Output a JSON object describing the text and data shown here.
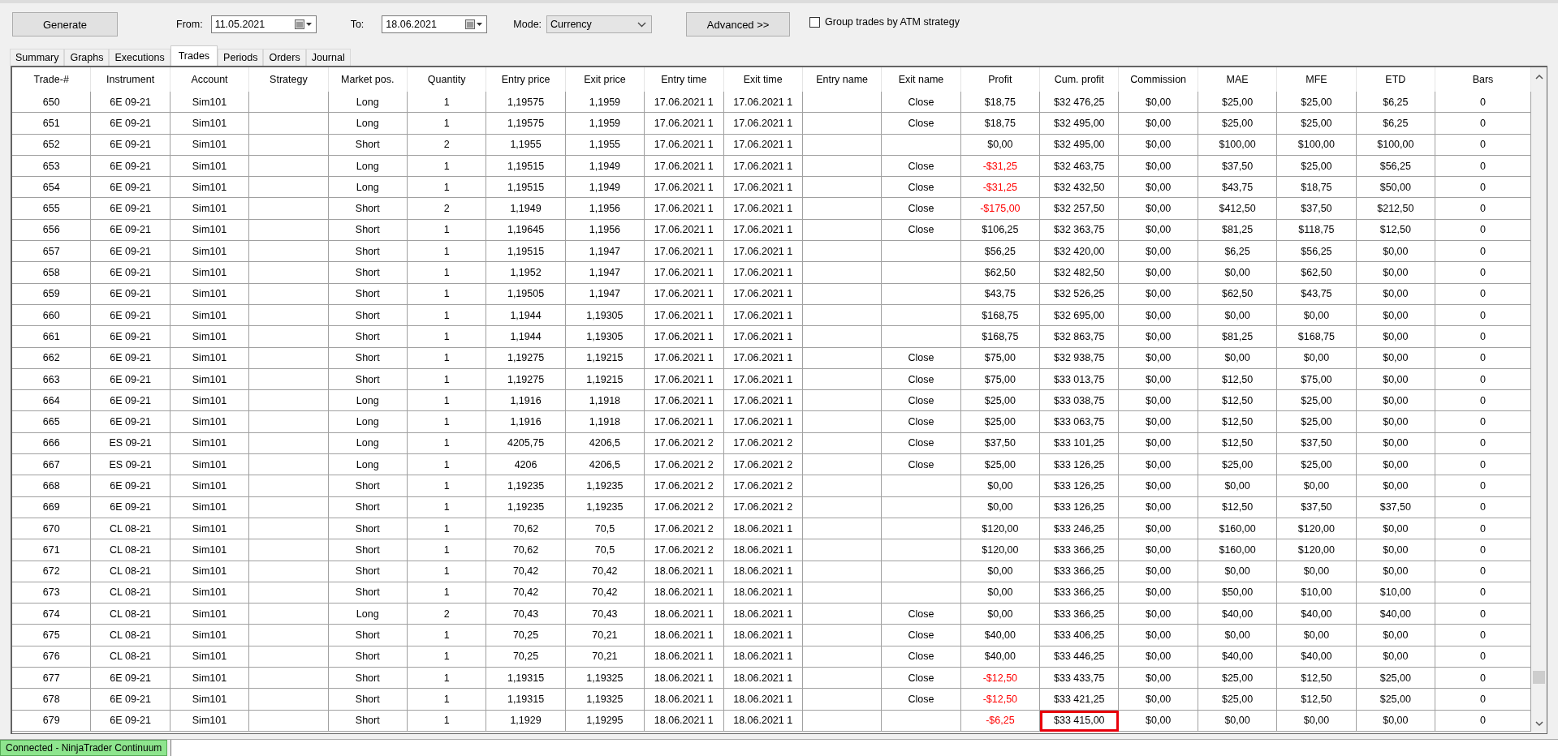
{
  "toolbar": {
    "generate_button": "Generate",
    "from_label": "From:",
    "from_date": "11.05.2021",
    "to_label": "To:",
    "to_date": "18.06.2021",
    "mode_label": "Mode:",
    "mode_value": "Currency",
    "advanced_button": "Advanced >>",
    "group_checkbox": {
      "label": "Group trades by ATM strategy",
      "checked": false
    }
  },
  "tabs": [
    {
      "label": "Summary",
      "selected": false
    },
    {
      "label": "Graphs",
      "selected": false
    },
    {
      "label": "Executions",
      "selected": false
    },
    {
      "label": "Trades",
      "selected": true
    },
    {
      "label": "Periods",
      "selected": false
    },
    {
      "label": "Orders",
      "selected": false
    },
    {
      "label": "Journal",
      "selected": false
    }
  ],
  "table": {
    "columns": [
      "Trade-#",
      "Instrument",
      "Account",
      "Strategy",
      "Market pos.",
      "Quantity",
      "Entry price",
      "Exit price",
      "Entry time",
      "Exit time",
      "Entry name",
      "Exit name",
      "Profit",
      "Cum. profit",
      "Commission",
      "MAE",
      "MFE",
      "ETD",
      "Bars"
    ],
    "rows": [
      {
        "cells": [
          "650",
          "6E 09-21",
          "Sim101",
          null,
          "Long",
          "1",
          "1,19575",
          "1,1959",
          "17.06.2021 1",
          "17.06.2021 1",
          null,
          "Close",
          "$18,75",
          "$32 476,25",
          "$0,00",
          "$25,00",
          "$25,00",
          "$6,25",
          "0"
        ],
        "loss": false,
        "highlighted": false
      },
      {
        "cells": [
          "651",
          "6E 09-21",
          "Sim101",
          null,
          "Long",
          "1",
          "1,19575",
          "1,1959",
          "17.06.2021 1",
          "17.06.2021 1",
          null,
          "Close",
          "$18,75",
          "$32 495,00",
          "$0,00",
          "$25,00",
          "$25,00",
          "$6,25",
          "0"
        ],
        "loss": false,
        "highlighted": false
      },
      {
        "cells": [
          "652",
          "6E 09-21",
          "Sim101",
          null,
          "Short",
          "2",
          "1,1955",
          "1,1955",
          "17.06.2021 1",
          "17.06.2021 1",
          null,
          null,
          "$0,00",
          "$32 495,00",
          "$0,00",
          "$100,00",
          "$100,00",
          "$100,00",
          "0"
        ],
        "loss": false,
        "highlighted": false
      },
      {
        "cells": [
          "653",
          "6E 09-21",
          "Sim101",
          null,
          "Long",
          "1",
          "1,19515",
          "1,1949",
          "17.06.2021 1",
          "17.06.2021 1",
          null,
          "Close",
          "-$31,25",
          "$32 463,75",
          "$0,00",
          "$37,50",
          "$25,00",
          "$56,25",
          "0"
        ],
        "loss": true,
        "highlighted": false
      },
      {
        "cells": [
          "654",
          "6E 09-21",
          "Sim101",
          null,
          "Long",
          "1",
          "1,19515",
          "1,1949",
          "17.06.2021 1",
          "17.06.2021 1",
          null,
          "Close",
          "-$31,25",
          "$32 432,50",
          "$0,00",
          "$43,75",
          "$18,75",
          "$50,00",
          "0"
        ],
        "loss": true,
        "highlighted": false
      },
      {
        "cells": [
          "655",
          "6E 09-21",
          "Sim101",
          null,
          "Short",
          "2",
          "1,1949",
          "1,1956",
          "17.06.2021 1",
          "17.06.2021 1",
          null,
          "Close",
          "-$175,00",
          "$32 257,50",
          "$0,00",
          "$412,50",
          "$37,50",
          "$212,50",
          "0"
        ],
        "loss": true,
        "highlighted": false
      },
      {
        "cells": [
          "656",
          "6E 09-21",
          "Sim101",
          null,
          "Short",
          "1",
          "1,19645",
          "1,1956",
          "17.06.2021 1",
          "17.06.2021 1",
          null,
          "Close",
          "$106,25",
          "$32 363,75",
          "$0,00",
          "$81,25",
          "$118,75",
          "$12,50",
          "0"
        ],
        "loss": false,
        "highlighted": false
      },
      {
        "cells": [
          "657",
          "6E 09-21",
          "Sim101",
          null,
          "Short",
          "1",
          "1,19515",
          "1,1947",
          "17.06.2021 1",
          "17.06.2021 1",
          null,
          null,
          "$56,25",
          "$32 420,00",
          "$0,00",
          "$6,25",
          "$56,25",
          "$0,00",
          "0"
        ],
        "loss": false,
        "highlighted": false
      },
      {
        "cells": [
          "658",
          "6E 09-21",
          "Sim101",
          null,
          "Short",
          "1",
          "1,1952",
          "1,1947",
          "17.06.2021 1",
          "17.06.2021 1",
          null,
          null,
          "$62,50",
          "$32 482,50",
          "$0,00",
          "$0,00",
          "$62,50",
          "$0,00",
          "0"
        ],
        "loss": false,
        "highlighted": false
      },
      {
        "cells": [
          "659",
          "6E 09-21",
          "Sim101",
          null,
          "Short",
          "1",
          "1,19505",
          "1,1947",
          "17.06.2021 1",
          "17.06.2021 1",
          null,
          null,
          "$43,75",
          "$32 526,25",
          "$0,00",
          "$62,50",
          "$43,75",
          "$0,00",
          "0"
        ],
        "loss": false,
        "highlighted": false
      },
      {
        "cells": [
          "660",
          "6E 09-21",
          "Sim101",
          null,
          "Short",
          "1",
          "1,1944",
          "1,19305",
          "17.06.2021 1",
          "17.06.2021 1",
          null,
          null,
          "$168,75",
          "$32 695,00",
          "$0,00",
          "$0,00",
          "$0,00",
          "$0,00",
          "0"
        ],
        "loss": false,
        "highlighted": false
      },
      {
        "cells": [
          "661",
          "6E 09-21",
          "Sim101",
          null,
          "Short",
          "1",
          "1,1944",
          "1,19305",
          "17.06.2021 1",
          "17.06.2021 1",
          null,
          null,
          "$168,75",
          "$32 863,75",
          "$0,00",
          "$81,25",
          "$168,75",
          "$0,00",
          "0"
        ],
        "loss": false,
        "highlighted": false
      },
      {
        "cells": [
          "662",
          "6E 09-21",
          "Sim101",
          null,
          "Short",
          "1",
          "1,19275",
          "1,19215",
          "17.06.2021 1",
          "17.06.2021 1",
          null,
          "Close",
          "$75,00",
          "$32 938,75",
          "$0,00",
          "$0,00",
          "$0,00",
          "$0,00",
          "0"
        ],
        "loss": false,
        "highlighted": false
      },
      {
        "cells": [
          "663",
          "6E 09-21",
          "Sim101",
          null,
          "Short",
          "1",
          "1,19275",
          "1,19215",
          "17.06.2021 1",
          "17.06.2021 1",
          null,
          "Close",
          "$75,00",
          "$33 013,75",
          "$0,00",
          "$12,50",
          "$75,00",
          "$0,00",
          "0"
        ],
        "loss": false,
        "highlighted": false
      },
      {
        "cells": [
          "664",
          "6E 09-21",
          "Sim101",
          null,
          "Long",
          "1",
          "1,1916",
          "1,1918",
          "17.06.2021 1",
          "17.06.2021 1",
          null,
          "Close",
          "$25,00",
          "$33 038,75",
          "$0,00",
          "$12,50",
          "$25,00",
          "$0,00",
          "0"
        ],
        "loss": false,
        "highlighted": false
      },
      {
        "cells": [
          "665",
          "6E 09-21",
          "Sim101",
          null,
          "Long",
          "1",
          "1,1916",
          "1,1918",
          "17.06.2021 1",
          "17.06.2021 1",
          null,
          "Close",
          "$25,00",
          "$33 063,75",
          "$0,00",
          "$12,50",
          "$25,00",
          "$0,00",
          "0"
        ],
        "loss": false,
        "highlighted": false
      },
      {
        "cells": [
          "666",
          "ES 09-21",
          "Sim101",
          null,
          "Long",
          "1",
          "4205,75",
          "4206,5",
          "17.06.2021 2",
          "17.06.2021 2",
          null,
          "Close",
          "$37,50",
          "$33 101,25",
          "$0,00",
          "$12,50",
          "$37,50",
          "$0,00",
          "0"
        ],
        "loss": false,
        "highlighted": false
      },
      {
        "cells": [
          "667",
          "ES 09-21",
          "Sim101",
          null,
          "Long",
          "1",
          "4206",
          "4206,5",
          "17.06.2021 2",
          "17.06.2021 2",
          null,
          "Close",
          "$25,00",
          "$33 126,25",
          "$0,00",
          "$25,00",
          "$25,00",
          "$0,00",
          "0"
        ],
        "loss": false,
        "highlighted": false
      },
      {
        "cells": [
          "668",
          "6E 09-21",
          "Sim101",
          null,
          "Short",
          "1",
          "1,19235",
          "1,19235",
          "17.06.2021 2",
          "17.06.2021 2",
          null,
          null,
          "$0,00",
          "$33 126,25",
          "$0,00",
          "$0,00",
          "$0,00",
          "$0,00",
          "0"
        ],
        "loss": false,
        "highlighted": false
      },
      {
        "cells": [
          "669",
          "6E 09-21",
          "Sim101",
          null,
          "Short",
          "1",
          "1,19235",
          "1,19235",
          "17.06.2021 2",
          "17.06.2021 2",
          null,
          null,
          "$0,00",
          "$33 126,25",
          "$0,00",
          "$12,50",
          "$37,50",
          "$37,50",
          "0"
        ],
        "loss": false,
        "highlighted": false
      },
      {
        "cells": [
          "670",
          "CL 08-21",
          "Sim101",
          null,
          "Short",
          "1",
          "70,62",
          "70,5",
          "17.06.2021 2",
          "18.06.2021 1",
          null,
          null,
          "$120,00",
          "$33 246,25",
          "$0,00",
          "$160,00",
          "$120,00",
          "$0,00",
          "0"
        ],
        "loss": false,
        "highlighted": false
      },
      {
        "cells": [
          "671",
          "CL 08-21",
          "Sim101",
          null,
          "Short",
          "1",
          "70,62",
          "70,5",
          "17.06.2021 2",
          "18.06.2021 1",
          null,
          null,
          "$120,00",
          "$33 366,25",
          "$0,00",
          "$160,00",
          "$120,00",
          "$0,00",
          "0"
        ],
        "loss": false,
        "highlighted": false
      },
      {
        "cells": [
          "672",
          "CL 08-21",
          "Sim101",
          null,
          "Short",
          "1",
          "70,42",
          "70,42",
          "18.06.2021 1",
          "18.06.2021 1",
          null,
          null,
          "$0,00",
          "$33 366,25",
          "$0,00",
          "$0,00",
          "$0,00",
          "$0,00",
          "0"
        ],
        "loss": false,
        "highlighted": false
      },
      {
        "cells": [
          "673",
          "CL 08-21",
          "Sim101",
          null,
          "Short",
          "1",
          "70,42",
          "70,42",
          "18.06.2021 1",
          "18.06.2021 1",
          null,
          null,
          "$0,00",
          "$33 366,25",
          "$0,00",
          "$50,00",
          "$10,00",
          "$10,00",
          "0"
        ],
        "loss": false,
        "highlighted": false
      },
      {
        "cells": [
          "674",
          "CL 08-21",
          "Sim101",
          null,
          "Long",
          "2",
          "70,43",
          "70,43",
          "18.06.2021 1",
          "18.06.2021 1",
          null,
          "Close",
          "$0,00",
          "$33 366,25",
          "$0,00",
          "$40,00",
          "$40,00",
          "$40,00",
          "0"
        ],
        "loss": false,
        "highlighted": false
      },
      {
        "cells": [
          "675",
          "CL 08-21",
          "Sim101",
          null,
          "Short",
          "1",
          "70,25",
          "70,21",
          "18.06.2021 1",
          "18.06.2021 1",
          null,
          "Close",
          "$40,00",
          "$33 406,25",
          "$0,00",
          "$0,00",
          "$0,00",
          "$0,00",
          "0"
        ],
        "loss": false,
        "highlighted": false
      },
      {
        "cells": [
          "676",
          "CL 08-21",
          "Sim101",
          null,
          "Short",
          "1",
          "70,25",
          "70,21",
          "18.06.2021 1",
          "18.06.2021 1",
          null,
          "Close",
          "$40,00",
          "$33 446,25",
          "$0,00",
          "$40,00",
          "$40,00",
          "$0,00",
          "0"
        ],
        "loss": false,
        "highlighted": false
      },
      {
        "cells": [
          "677",
          "6E 09-21",
          "Sim101",
          null,
          "Short",
          "1",
          "1,19315",
          "1,19325",
          "18.06.2021 1",
          "18.06.2021 1",
          null,
          "Close",
          "-$12,50",
          "$33 433,75",
          "$0,00",
          "$25,00",
          "$12,50",
          "$25,00",
          "0"
        ],
        "loss": true,
        "highlighted": false
      },
      {
        "cells": [
          "678",
          "6E 09-21",
          "Sim101",
          null,
          "Short",
          "1",
          "1,19315",
          "1,19325",
          "18.06.2021 1",
          "18.06.2021 1",
          null,
          "Close",
          "-$12,50",
          "$33 421,25",
          "$0,00",
          "$25,00",
          "$12,50",
          "$25,00",
          "0"
        ],
        "loss": true,
        "highlighted": false
      },
      {
        "cells": [
          "679",
          "6E 09-21",
          "Sim101",
          null,
          "Short",
          "1",
          "1,1929",
          "1,19295",
          "18.06.2021 1",
          "18.06.2021 1",
          null,
          null,
          "-$6,25",
          "$33 415,00",
          "$0,00",
          "$0,00",
          "$0,00",
          "$0,00",
          "0"
        ],
        "loss": true,
        "highlighted": true
      }
    ]
  },
  "status_bar": {
    "connection": "Connected - NinjaTrader Continuum"
  }
}
